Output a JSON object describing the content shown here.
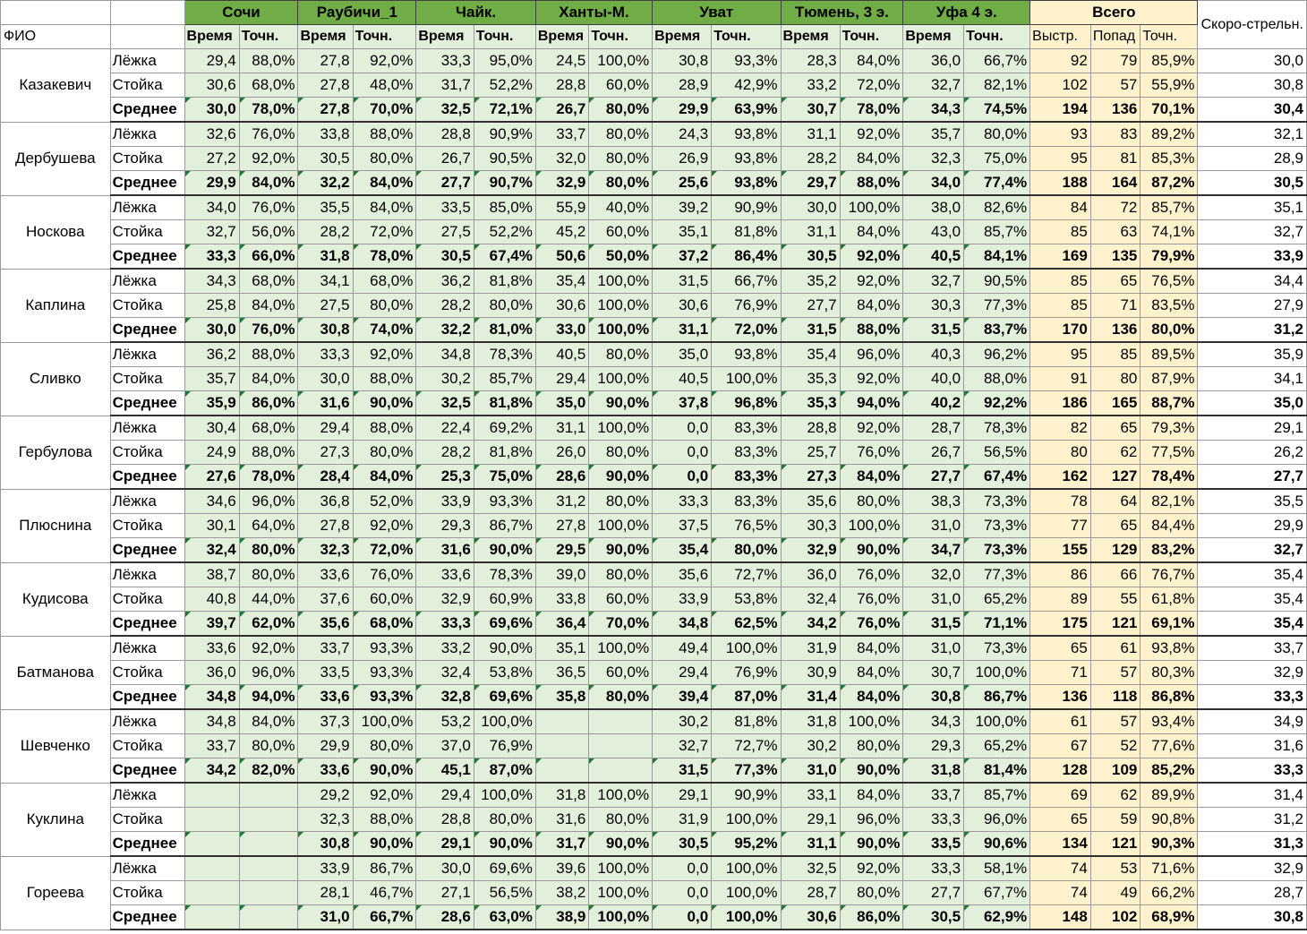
{
  "header": {
    "fio": "ФИО",
    "speed": "Скоро-стрельн.",
    "total": "Всего",
    "venues": [
      "Сочи",
      "Раубичи_1",
      "Чайк.",
      "Ханты-М.",
      "Уват",
      "Тюмень, 3 э.",
      "Уфа 4 э."
    ],
    "sub_labels": [
      "Время",
      "Точн.",
      "Время",
      "Точн.",
      "Время",
      "Точн.",
      "Время",
      "Точн.",
      "Время",
      "Точн.",
      "Время",
      "Точн.",
      "Время",
      "Точн."
    ],
    "total_labels": [
      "Выстр.",
      "Попад",
      "Точн."
    ]
  },
  "colors": {
    "venue_header": "#70ad47",
    "cell_green": "#e2efda",
    "cell_total": "#fff2cc",
    "mark": "#1e7b34"
  },
  "athletes": [
    {
      "name": "Казакевич",
      "rows": [
        {
          "kind": "Лёжка",
          "v": [
            "29,4",
            "88,0%",
            "27,8",
            "92,0%",
            "33,3",
            "95,0%",
            "24,5",
            "100,0%",
            "30,8",
            "93,3%",
            "28,3",
            "84,0%",
            "36,0",
            "66,7%"
          ],
          "t": [
            "92",
            "79",
            "85,9%"
          ],
          "s": "30,0"
        },
        {
          "kind": "Стойка",
          "v": [
            "30,6",
            "68,0%",
            "27,8",
            "48,0%",
            "31,7",
            "52,2%",
            "28,8",
            "60,0%",
            "28,9",
            "42,9%",
            "33,2",
            "72,0%",
            "32,7",
            "82,1%"
          ],
          "t": [
            "102",
            "57",
            "55,9%"
          ],
          "s": "30,8"
        },
        {
          "kind": "Среднее",
          "v": [
            "30,0",
            "78,0%",
            "27,8",
            "70,0%",
            "32,5",
            "72,1%",
            "26,7",
            "80,0%",
            "29,9",
            "63,9%",
            "30,7",
            "78,0%",
            "34,3",
            "74,5%"
          ],
          "t": [
            "194",
            "136",
            "70,1%"
          ],
          "s": "30,4"
        }
      ]
    },
    {
      "name": "Дербушева",
      "rows": [
        {
          "kind": "Лёжка",
          "v": [
            "32,6",
            "76,0%",
            "33,8",
            "88,0%",
            "28,8",
            "90,9%",
            "33,7",
            "80,0%",
            "24,3",
            "93,8%",
            "31,1",
            "92,0%",
            "35,7",
            "80,0%"
          ],
          "t": [
            "93",
            "83",
            "89,2%"
          ],
          "s": "32,1"
        },
        {
          "kind": "Стойка",
          "v": [
            "27,2",
            "92,0%",
            "30,5",
            "80,0%",
            "26,7",
            "90,5%",
            "32,0",
            "80,0%",
            "26,9",
            "93,8%",
            "28,2",
            "84,0%",
            "32,3",
            "75,0%"
          ],
          "t": [
            "95",
            "81",
            "85,3%"
          ],
          "s": "28,9"
        },
        {
          "kind": "Среднее",
          "v": [
            "29,9",
            "84,0%",
            "32,2",
            "84,0%",
            "27,7",
            "90,7%",
            "32,9",
            "80,0%",
            "25,6",
            "93,8%",
            "29,7",
            "88,0%",
            "34,0",
            "77,4%"
          ],
          "t": [
            "188",
            "164",
            "87,2%"
          ],
          "s": "30,5"
        }
      ]
    },
    {
      "name": "Носкова",
      "rows": [
        {
          "kind": "Лёжка",
          "v": [
            "34,0",
            "76,0%",
            "35,5",
            "84,0%",
            "33,5",
            "85,0%",
            "55,9",
            "40,0%",
            "39,2",
            "90,9%",
            "30,0",
            "100,0%",
            "38,0",
            "82,6%"
          ],
          "t": [
            "84",
            "72",
            "85,7%"
          ],
          "s": "35,1"
        },
        {
          "kind": "Стойка",
          "v": [
            "32,7",
            "56,0%",
            "28,2",
            "72,0%",
            "27,5",
            "52,2%",
            "45,2",
            "60,0%",
            "35,1",
            "81,8%",
            "31,1",
            "84,0%",
            "43,0",
            "85,7%"
          ],
          "t": [
            "85",
            "63",
            "74,1%"
          ],
          "s": "32,7"
        },
        {
          "kind": "Среднее",
          "v": [
            "33,3",
            "66,0%",
            "31,8",
            "78,0%",
            "30,5",
            "67,4%",
            "50,6",
            "50,0%",
            "37,2",
            "86,4%",
            "30,5",
            "92,0%",
            "40,5",
            "84,1%"
          ],
          "t": [
            "169",
            "135",
            "79,9%"
          ],
          "s": "33,9"
        }
      ]
    },
    {
      "name": "Каплина",
      "rows": [
        {
          "kind": "Лёжка",
          "v": [
            "34,3",
            "68,0%",
            "34,1",
            "68,0%",
            "36,2",
            "81,8%",
            "35,4",
            "100,0%",
            "31,5",
            "66,7%",
            "35,2",
            "92,0%",
            "32,7",
            "90,5%"
          ],
          "t": [
            "85",
            "65",
            "76,5%"
          ],
          "s": "34,4"
        },
        {
          "kind": "Стойка",
          "v": [
            "25,8",
            "84,0%",
            "27,5",
            "80,0%",
            "28,2",
            "80,0%",
            "30,6",
            "100,0%",
            "30,6",
            "76,9%",
            "27,7",
            "84,0%",
            "30,3",
            "77,3%"
          ],
          "t": [
            "85",
            "71",
            "83,5%"
          ],
          "s": "27,9"
        },
        {
          "kind": "Среднее",
          "v": [
            "30,0",
            "76,0%",
            "30,8",
            "74,0%",
            "32,2",
            "81,0%",
            "33,0",
            "100,0%",
            "31,1",
            "72,0%",
            "31,5",
            "88,0%",
            "31,5",
            "83,7%"
          ],
          "t": [
            "170",
            "136",
            "80,0%"
          ],
          "s": "31,2"
        }
      ]
    },
    {
      "name": "Сливко",
      "rows": [
        {
          "kind": "Лёжка",
          "v": [
            "36,2",
            "88,0%",
            "33,3",
            "92,0%",
            "34,8",
            "78,3%",
            "40,5",
            "80,0%",
            "35,0",
            "93,8%",
            "35,4",
            "96,0%",
            "40,3",
            "96,2%"
          ],
          "t": [
            "95",
            "85",
            "89,5%"
          ],
          "s": "35,9"
        },
        {
          "kind": "Стойка",
          "v": [
            "35,7",
            "84,0%",
            "30,0",
            "88,0%",
            "30,2",
            "85,7%",
            "29,4",
            "100,0%",
            "40,5",
            "100,0%",
            "35,3",
            "92,0%",
            "40,0",
            "88,0%"
          ],
          "t": [
            "91",
            "80",
            "87,9%"
          ],
          "s": "34,1"
        },
        {
          "kind": "Среднее",
          "v": [
            "35,9",
            "86,0%",
            "31,6",
            "90,0%",
            "32,5",
            "81,8%",
            "35,0",
            "90,0%",
            "37,8",
            "96,8%",
            "35,3",
            "94,0%",
            "40,2",
            "92,2%"
          ],
          "t": [
            "186",
            "165",
            "88,7%"
          ],
          "s": "35,0"
        }
      ]
    },
    {
      "name": "Гербулова",
      "rows": [
        {
          "kind": "Лёжка",
          "v": [
            "30,4",
            "68,0%",
            "29,4",
            "88,0%",
            "22,4",
            "69,2%",
            "31,1",
            "100,0%",
            "0,0",
            "83,3%",
            "28,8",
            "92,0%",
            "28,7",
            "78,3%"
          ],
          "t": [
            "82",
            "65",
            "79,3%"
          ],
          "s": "29,1"
        },
        {
          "kind": "Стойка",
          "v": [
            "24,9",
            "88,0%",
            "27,3",
            "80,0%",
            "28,2",
            "81,8%",
            "26,0",
            "80,0%",
            "0,0",
            "83,3%",
            "25,7",
            "76,0%",
            "26,7",
            "56,5%"
          ],
          "t": [
            "80",
            "62",
            "77,5%"
          ],
          "s": "26,2"
        },
        {
          "kind": "Среднее",
          "v": [
            "27,6",
            "78,0%",
            "28,4",
            "84,0%",
            "25,3",
            "75,0%",
            "28,6",
            "90,0%",
            "0,0",
            "83,3%",
            "27,3",
            "84,0%",
            "27,7",
            "67,4%"
          ],
          "t": [
            "162",
            "127",
            "78,4%"
          ],
          "s": "27,7"
        }
      ]
    },
    {
      "name": "Плюснина",
      "rows": [
        {
          "kind": "Лёжка",
          "v": [
            "34,6",
            "96,0%",
            "36,8",
            "52,0%",
            "33,9",
            "93,3%",
            "31,2",
            "80,0%",
            "33,3",
            "83,3%",
            "35,6",
            "80,0%",
            "38,3",
            "73,3%"
          ],
          "t": [
            "78",
            "64",
            "82,1%"
          ],
          "s": "35,5"
        },
        {
          "kind": "Стойка",
          "v": [
            "30,1",
            "64,0%",
            "27,8",
            "92,0%",
            "29,3",
            "86,7%",
            "27,8",
            "100,0%",
            "37,5",
            "76,5%",
            "30,3",
            "100,0%",
            "31,0",
            "73,3%"
          ],
          "t": [
            "77",
            "65",
            "84,4%"
          ],
          "s": "29,9"
        },
        {
          "kind": "Среднее",
          "v": [
            "32,4",
            "80,0%",
            "32,3",
            "72,0%",
            "31,6",
            "90,0%",
            "29,5",
            "90,0%",
            "35,4",
            "80,0%",
            "32,9",
            "90,0%",
            "34,7",
            "73,3%"
          ],
          "t": [
            "155",
            "129",
            "83,2%"
          ],
          "s": "32,7"
        }
      ]
    },
    {
      "name": "Кудисова",
      "rows": [
        {
          "kind": "Лёжка",
          "v": [
            "38,7",
            "80,0%",
            "33,6",
            "76,0%",
            "33,6",
            "78,3%",
            "39,0",
            "80,0%",
            "35,6",
            "72,7%",
            "36,0",
            "76,0%",
            "32,0",
            "77,3%"
          ],
          "t": [
            "86",
            "66",
            "76,7%"
          ],
          "s": "35,4"
        },
        {
          "kind": "Стойка",
          "v": [
            "40,8",
            "44,0%",
            "37,6",
            "60,0%",
            "32,9",
            "60,9%",
            "33,8",
            "60,0%",
            "33,9",
            "53,8%",
            "32,4",
            "76,0%",
            "31,0",
            "65,2%"
          ],
          "t": [
            "89",
            "55",
            "61,8%"
          ],
          "s": "35,4"
        },
        {
          "kind": "Среднее",
          "v": [
            "39,7",
            "62,0%",
            "35,6",
            "68,0%",
            "33,3",
            "69,6%",
            "36,4",
            "70,0%",
            "34,8",
            "62,5%",
            "34,2",
            "76,0%",
            "31,5",
            "71,1%"
          ],
          "t": [
            "175",
            "121",
            "69,1%"
          ],
          "s": "35,4"
        }
      ]
    },
    {
      "name": "Батманова",
      "rows": [
        {
          "kind": "Лёжка",
          "v": [
            "33,6",
            "92,0%",
            "33,7",
            "93,3%",
            "33,2",
            "90,0%",
            "35,1",
            "100,0%",
            "49,4",
            "100,0%",
            "31,9",
            "84,0%",
            "31,0",
            "73,3%"
          ],
          "t": [
            "65",
            "61",
            "93,8%"
          ],
          "s": "33,7"
        },
        {
          "kind": "Стойка",
          "v": [
            "36,0",
            "96,0%",
            "33,5",
            "93,3%",
            "32,4",
            "53,8%",
            "36,5",
            "60,0%",
            "29,4",
            "76,9%",
            "30,9",
            "84,0%",
            "30,7",
            "100,0%"
          ],
          "t": [
            "71",
            "57",
            "80,3%"
          ],
          "s": "32,9"
        },
        {
          "kind": "Среднее",
          "v": [
            "34,8",
            "94,0%",
            "33,6",
            "93,3%",
            "32,8",
            "69,6%",
            "35,8",
            "80,0%",
            "39,4",
            "87,0%",
            "31,4",
            "84,0%",
            "30,8",
            "86,7%"
          ],
          "t": [
            "136",
            "118",
            "86,8%"
          ],
          "s": "33,3"
        }
      ]
    },
    {
      "name": "Шевченко",
      "rows": [
        {
          "kind": "Лёжка",
          "v": [
            "34,8",
            "84,0%",
            "37,3",
            "100,0%",
            "53,2",
            "100,0%",
            "",
            "",
            "30,2",
            "81,8%",
            "31,8",
            "100,0%",
            "34,3",
            "100,0%"
          ],
          "t": [
            "61",
            "57",
            "93,4%"
          ],
          "s": "34,9"
        },
        {
          "kind": "Стойка",
          "v": [
            "33,7",
            "80,0%",
            "29,9",
            "80,0%",
            "37,0",
            "76,9%",
            "",
            "",
            "32,7",
            "72,7%",
            "30,2",
            "80,0%",
            "29,3",
            "65,2%"
          ],
          "t": [
            "67",
            "52",
            "77,6%"
          ],
          "s": "31,6"
        },
        {
          "kind": "Среднее",
          "v": [
            "34,2",
            "82,0%",
            "33,6",
            "90,0%",
            "45,1",
            "87,0%",
            "",
            "",
            "31,5",
            "77,3%",
            "31,0",
            "90,0%",
            "31,8",
            "81,4%"
          ],
          "t": [
            "128",
            "109",
            "85,2%"
          ],
          "s": "33,3"
        }
      ]
    },
    {
      "name": "Куклина",
      "rows": [
        {
          "kind": "Лёжка",
          "v": [
            "",
            "",
            "29,2",
            "92,0%",
            "29,4",
            "100,0%",
            "31,8",
            "100,0%",
            "29,1",
            "90,9%",
            "33,1",
            "84,0%",
            "33,7",
            "85,7%"
          ],
          "t": [
            "69",
            "62",
            "89,9%"
          ],
          "s": "31,4"
        },
        {
          "kind": "Стойка",
          "v": [
            "",
            "",
            "32,3",
            "88,0%",
            "28,8",
            "80,0%",
            "31,6",
            "80,0%",
            "31,9",
            "100,0%",
            "29,1",
            "96,0%",
            "33,3",
            "96,0%"
          ],
          "t": [
            "65",
            "59",
            "90,8%"
          ],
          "s": "31,2"
        },
        {
          "kind": "Среднее",
          "v": [
            "",
            "",
            "30,8",
            "90,0%",
            "29,1",
            "90,0%",
            "31,7",
            "90,0%",
            "30,5",
            "95,2%",
            "31,1",
            "90,0%",
            "33,5",
            "90,6%"
          ],
          "t": [
            "134",
            "121",
            "90,3%"
          ],
          "s": "31,3"
        }
      ]
    },
    {
      "name": "Гореева",
      "rows": [
        {
          "kind": "Лёжка",
          "v": [
            "",
            "",
            "33,9",
            "86,7%",
            "30,0",
            "69,6%",
            "39,6",
            "100,0%",
            "0,0",
            "100,0%",
            "32,5",
            "92,0%",
            "33,3",
            "58,1%"
          ],
          "t": [
            "74",
            "53",
            "71,6%"
          ],
          "s": "32,9"
        },
        {
          "kind": "Стойка",
          "v": [
            "",
            "",
            "28,1",
            "46,7%",
            "27,1",
            "56,5%",
            "38,2",
            "100,0%",
            "0,0",
            "100,0%",
            "28,7",
            "80,0%",
            "27,7",
            "67,7%"
          ],
          "t": [
            "74",
            "49",
            "66,2%"
          ],
          "s": "28,7"
        },
        {
          "kind": "Среднее",
          "v": [
            "",
            "",
            "31,0",
            "66,7%",
            "28,6",
            "63,0%",
            "38,9",
            "100,0%",
            "0,0",
            "100,0%",
            "30,6",
            "86,0%",
            "30,5",
            "62,9%"
          ],
          "t": [
            "148",
            "102",
            "68,9%"
          ],
          "s": "30,8"
        }
      ]
    }
  ]
}
